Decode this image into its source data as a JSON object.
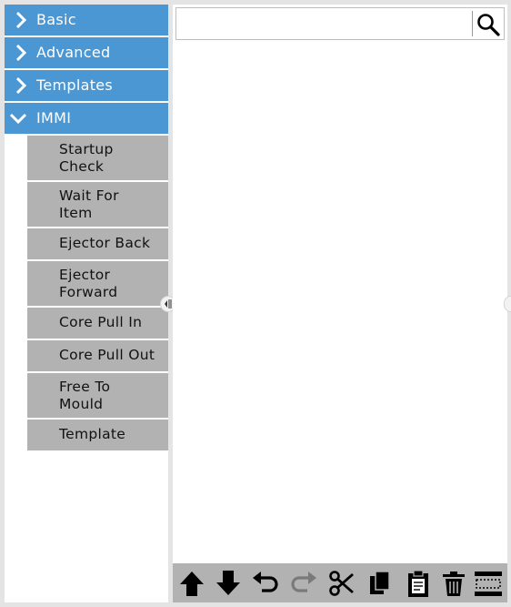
{
  "categories": [
    {
      "label": "Basic",
      "icon": "chevron-right-icon",
      "expanded": false
    },
    {
      "label": "Advanced",
      "icon": "chevron-right-icon",
      "expanded": false
    },
    {
      "label": "Templates",
      "icon": "chevron-right-icon",
      "expanded": false
    },
    {
      "label": "IMMI",
      "icon": "chevron-down-icon",
      "expanded": true
    }
  ],
  "immi_items": [
    {
      "label": "Startup\nCheck"
    },
    {
      "label": "Wait For\nItem"
    },
    {
      "label": "Ejector Back"
    },
    {
      "label": "Ejector\nForward"
    },
    {
      "label": "Core Pull In"
    },
    {
      "label": "Core Pull Out"
    },
    {
      "label": "Free To\nMould"
    },
    {
      "label": "Template"
    }
  ],
  "search": {
    "value": "",
    "placeholder": "",
    "icon": "search-icon"
  },
  "toolbar": {
    "buttons": [
      {
        "name": "move-up",
        "icon": "arrow-up-icon",
        "enabled": true
      },
      {
        "name": "move-down",
        "icon": "arrow-down-icon",
        "enabled": true
      },
      {
        "name": "undo",
        "icon": "undo-icon",
        "enabled": true
      },
      {
        "name": "redo",
        "icon": "redo-icon",
        "enabled": false
      },
      {
        "name": "cut",
        "icon": "scissors-icon",
        "enabled": true
      },
      {
        "name": "copy",
        "icon": "copy-icon",
        "enabled": true
      },
      {
        "name": "paste",
        "icon": "clipboard-icon",
        "enabled": true
      },
      {
        "name": "delete",
        "icon": "trash-icon",
        "enabled": true
      },
      {
        "name": "suppress",
        "icon": "suppress-icon",
        "enabled": true
      }
    ]
  },
  "colors": {
    "category_bg": "#4a97d3",
    "item_bg": "#b2b2b2",
    "toolbar_bg": "#b2b2b2",
    "disabled_icon": "#7a7a7a"
  }
}
